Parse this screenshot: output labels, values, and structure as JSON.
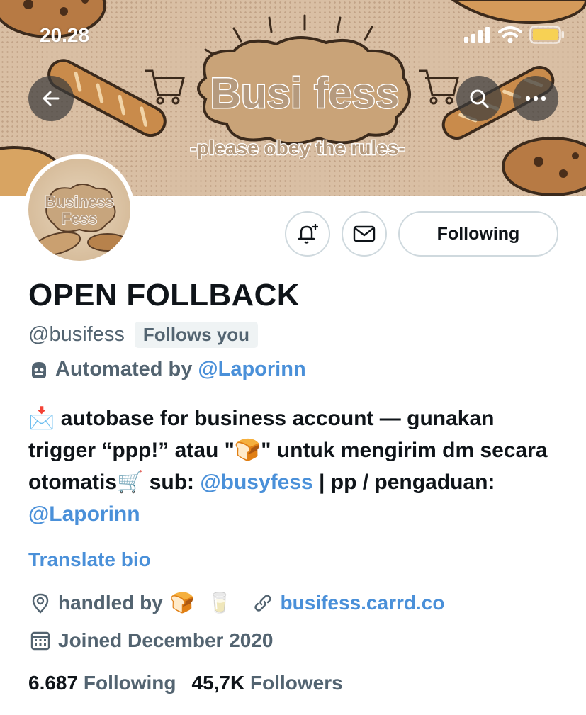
{
  "status_bar": {
    "time": "20.28"
  },
  "banner": {
    "title": "Busi fess",
    "tagline": "-please obey the rules-"
  },
  "avatar": {
    "line1": "Business",
    "line2": "Fess"
  },
  "actions": {
    "following_label": "Following"
  },
  "profile": {
    "display_name": "OPEN FOLLBACK",
    "handle": "@busifess",
    "follows_you": "Follows you",
    "automated_prefix": "Automated by",
    "automated_by": "@Laporinn"
  },
  "bio": {
    "emoji_inbox": "📩",
    "part1": "autobase for business account — gunakan trigger “ppp!” atau \"",
    "emoji_bread": "🍞",
    "part2": "\" untuk mengirim dm secara otomatis",
    "emoji_cart": "🛒",
    "part3": " sub: ",
    "mention_sub": "@busyfess",
    "part4": " | pp / pengaduan: ",
    "mention_pp": "@Laporinn"
  },
  "translate_label": "Translate bio",
  "meta": {
    "location_prefix": "handled by",
    "location_emoji1": "🍞",
    "location_emoji2": "🥛",
    "website": "busifess.carrd.co",
    "joined": "Joined December 2020"
  },
  "stats": {
    "following_count": "6.687",
    "following_label": "Following",
    "followers_count": "45,7K",
    "followers_label": "Followers"
  },
  "colors": {
    "link": "#4a90d9",
    "muted": "#536471",
    "text": "#0f1419"
  }
}
